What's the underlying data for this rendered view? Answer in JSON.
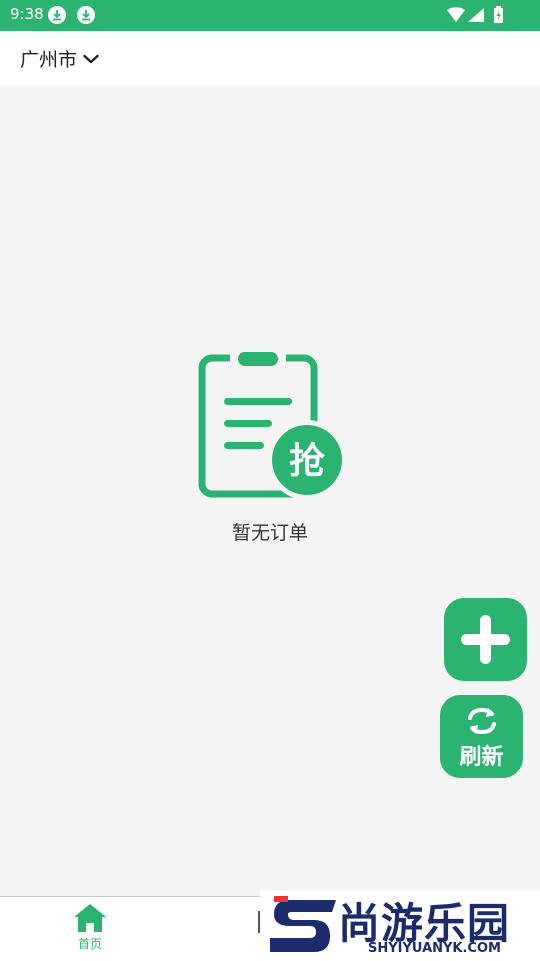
{
  "status_bar": {
    "time": "9:38",
    "icons": [
      "download-icon",
      "download-icon",
      "wifi-icon",
      "signal-icon",
      "battery-icon"
    ],
    "color": "#2bb371"
  },
  "header": {
    "city": "广州市",
    "dropdown_icon": "chevron-down-icon"
  },
  "empty_state": {
    "illustration_badge": "抢",
    "message": "暂无订单"
  },
  "actions": {
    "add_icon": "plus-icon",
    "refresh_icon": "refresh-icon",
    "refresh_label": "刷新"
  },
  "bottom_nav": {
    "home_label": "首页",
    "home_icon": "home-icon",
    "active_color": "#2bb371"
  },
  "watermark": {
    "title": "尚游乐园",
    "url": "SHYIYUANYK.COM"
  },
  "colors": {
    "accent": "#2bb371",
    "background": "#f4f4f4"
  }
}
